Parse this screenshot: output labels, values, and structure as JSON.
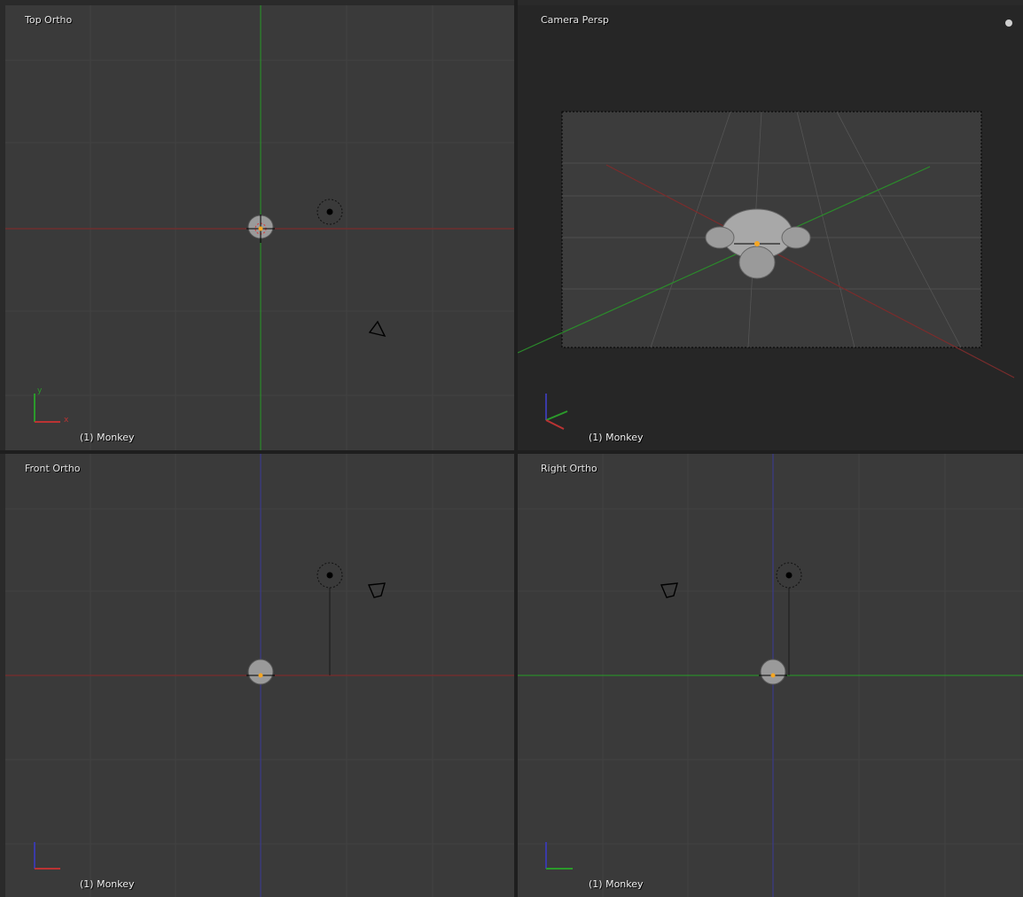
{
  "viewports": {
    "top": {
      "title": "Top Ortho",
      "object": "(1) Monkey"
    },
    "camera": {
      "title": "Camera Persp",
      "object": "(1) Monkey"
    },
    "front": {
      "title": "Front Ortho",
      "object": "(1) Monkey"
    },
    "right": {
      "title": "Right Ortho",
      "object": "(1) Monkey"
    }
  },
  "colors": {
    "background": "#3a3a3a",
    "camera_background": "#262626",
    "grid": "#404040",
    "x_axis": "#8a2e2e",
    "y_axis": "#2e8a2e",
    "z_axis": "#3a3a9a"
  },
  "icons": [
    "light-icon",
    "camera-icon",
    "monkey-mesh-icon",
    "axis-gizmo-icon",
    "settings-icon"
  ]
}
